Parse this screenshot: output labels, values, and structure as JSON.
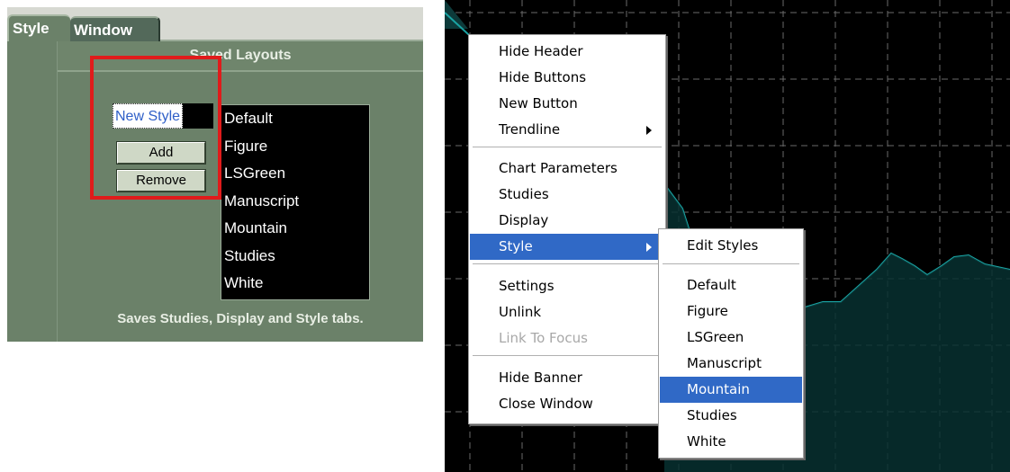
{
  "left_panel": {
    "tabs": [
      {
        "label": "Style"
      },
      {
        "label": "Window"
      }
    ],
    "section_title": "Saved Layouts",
    "style_name_value": "New Style",
    "add_label": "Add",
    "remove_label": "Remove",
    "layouts": [
      "Default",
      "Figure",
      "LSGreen",
      "Manuscript",
      "Mountain",
      "Studies",
      "White"
    ],
    "footer": "Saves Studies, Display and Style tabs."
  },
  "context_menu": {
    "items": [
      {
        "label": "Hide Header"
      },
      {
        "label": "Hide Buttons"
      },
      {
        "label": "New Button"
      },
      {
        "label": "Trendline"
      },
      {
        "label": "Chart Parameters"
      },
      {
        "label": "Studies"
      },
      {
        "label": "Display"
      },
      {
        "label": "Style"
      },
      {
        "label": "Settings"
      },
      {
        "label": "Unlink"
      },
      {
        "label": "Link To Focus"
      },
      {
        "label": "Hide Banner"
      },
      {
        "label": "Close Window"
      }
    ]
  },
  "style_submenu": {
    "edit_label": "Edit Styles",
    "items": [
      "Default",
      "Figure",
      "LSGreen",
      "Manuscript",
      "Mountain",
      "Studies",
      "White"
    ],
    "selected": "Mountain"
  },
  "colors": {
    "panel_green": "#6b8169",
    "highlight_red": "#e01b1b",
    "menu_selection": "#3069c6",
    "chart_line": "#1aa3a3"
  }
}
